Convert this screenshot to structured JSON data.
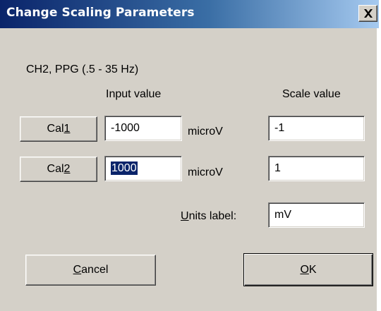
{
  "window": {
    "title": "Change Scaling Parameters",
    "close_icon": "close-icon"
  },
  "channel_label": "CH2, PPG (.5 - 35 Hz)",
  "headers": {
    "input_value": "Input value",
    "scale_value": "Scale value"
  },
  "rows": [
    {
      "button_prefix": "Cal",
      "button_mnemonic": "1",
      "input_value": "-1000",
      "unit": "microV",
      "scale_value": "-1"
    },
    {
      "button_prefix": "Cal",
      "button_mnemonic": "2",
      "input_value": "1000",
      "unit": "microV",
      "scale_value": "1"
    }
  ],
  "units": {
    "label_mnemonic": "U",
    "label_rest": "nits label:",
    "value": "mV"
  },
  "buttons": {
    "cancel_mnemonic": "C",
    "cancel_rest": "ancel",
    "ok_mnemonic": "O",
    "ok_rest": "K"
  },
  "colors": {
    "dialog_bg": "#d4d0c8",
    "titlebar_start": "#0a246a",
    "titlebar_end": "#a6caf0",
    "selection": "#0a246a"
  }
}
